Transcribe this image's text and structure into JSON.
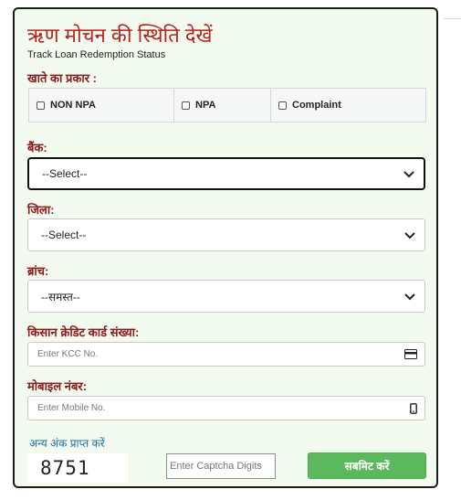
{
  "header": {
    "title": "ऋण मोचन की स्थिति देखें",
    "subtitle": "Track Loan Redemption Status"
  },
  "account_type": {
    "label": "खाते का प्रकार :",
    "options": [
      "NON NPA",
      "NPA",
      "Complaint"
    ]
  },
  "bank": {
    "label": "बैंक:",
    "selected": "--Select--"
  },
  "district": {
    "label": "जिला:",
    "selected": "--Select--"
  },
  "branch": {
    "label": "ब्रांच:",
    "selected": "--समस्त--"
  },
  "kcc": {
    "label": "किसान क्रेडिट कार्ड संख्या:",
    "placeholder": "Enter KCC No.",
    "icon": "credit-card-icon"
  },
  "mobile": {
    "label": "मोबाइल नंबर:",
    "placeholder": "Enter Mobile No.",
    "icon": "mobile-phone-icon"
  },
  "captcha": {
    "refresh_link": "अन्य अंक प्राप्त करें",
    "code": "8751",
    "placeholder": "Enter Captcha Digits"
  },
  "submit_label": "सबमिट करें",
  "colors": {
    "title": "#b3261e",
    "label": "#8a1c1c",
    "submit": "#5cb85c",
    "link": "#1f6f9d",
    "card_bg": "#f3fbf1"
  }
}
